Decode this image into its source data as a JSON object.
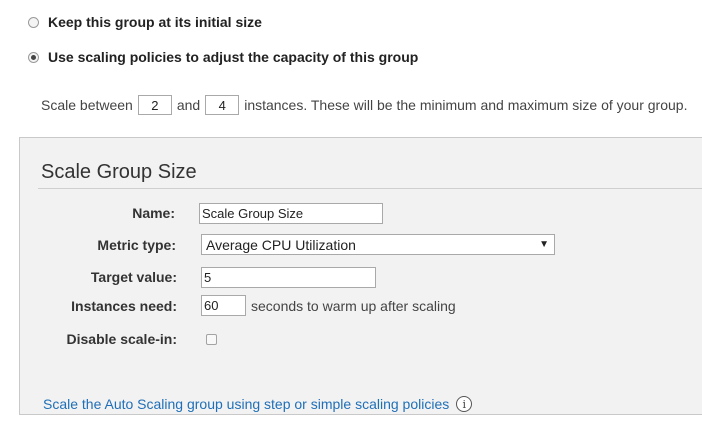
{
  "options": {
    "keep_initial_size": "Keep this group at its initial size",
    "use_scaling_policies": "Use scaling policies to adjust the capacity of this group"
  },
  "scale_between": {
    "prefix": "Scale between",
    "min_value": "2",
    "and_text": "and",
    "max_value": "4",
    "suffix": "instances. These will be the minimum and maximum size of your group."
  },
  "panel": {
    "title": "Scale Group Size",
    "name_label": "Name:",
    "name_value": "Scale Group Size",
    "metric_label": "Metric type:",
    "metric_value": "Average CPU Utilization",
    "target_label": "Target value:",
    "target_value": "5",
    "warmup_label": "Instances need:",
    "warmup_value": "60",
    "warmup_suffix": "seconds to warm up after scaling",
    "disable_label": "Disable scale-in:",
    "link_text": "Scale the Auto Scaling group using step or simple scaling policies",
    "info_glyph": "i"
  },
  "icons": {
    "info": "info-icon",
    "dropdown": "chevron-down-icon"
  },
  "colors": {
    "link": "#1f6fb8",
    "panel_background": "#f2f2f2"
  }
}
